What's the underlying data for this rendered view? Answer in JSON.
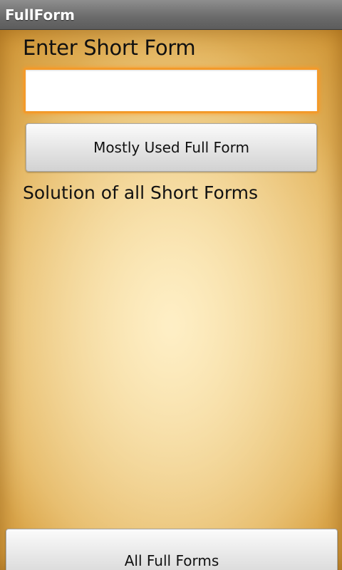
{
  "app": {
    "title": "FullForm"
  },
  "main": {
    "enter_label": "Enter Short Form",
    "input_value": "",
    "input_placeholder": "",
    "mostly_used_button": "Mostly Used Full Form",
    "solution_label": "Solution of all Short Forms",
    "all_full_forms_button": "All Full Forms"
  },
  "colors": {
    "title_bar": "#6a6a6a",
    "background": "#e3b45d",
    "input_focus_border": "#f39a2a",
    "button_face": "#e4e4e4"
  }
}
